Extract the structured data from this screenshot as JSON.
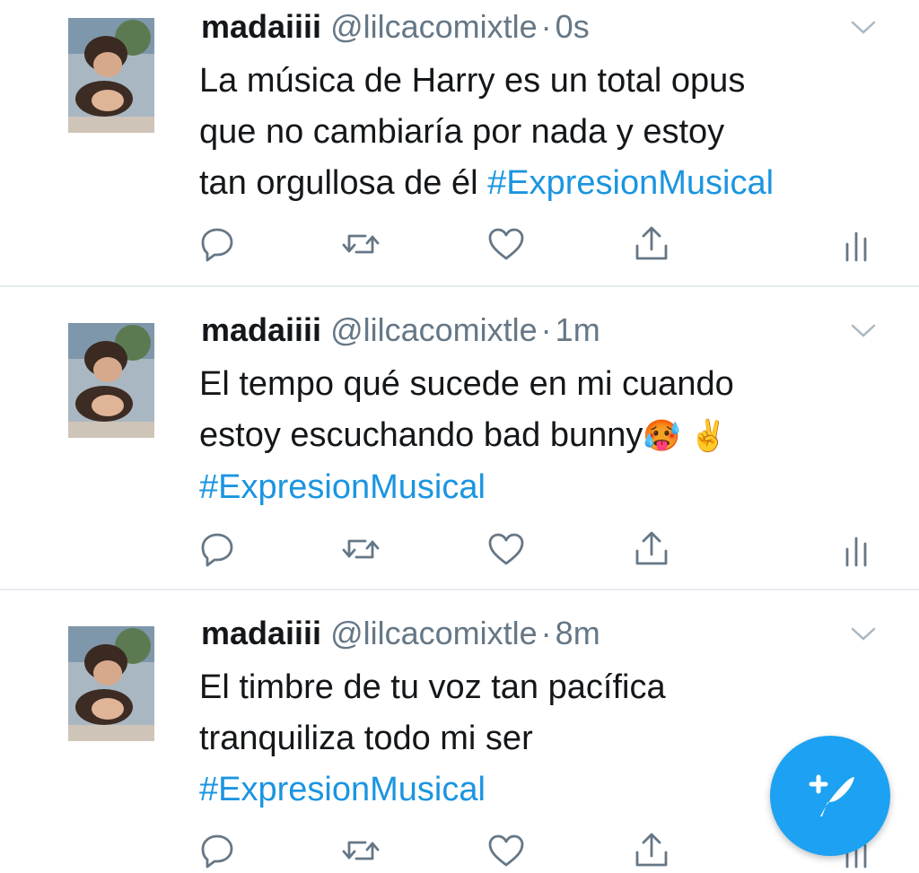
{
  "timeline": {
    "tweets": [
      {
        "name": "madaiiii",
        "handle": "@lilcacomixtle",
        "separator": "·",
        "time": "0s",
        "lines": [
          "La música de Harry es un total opus",
          "que no cambiaría por nada y estoy",
          "tan orgullosa de él"
        ],
        "hashtag": "#ExpresionMusical"
      },
      {
        "name": "madaiiii",
        "handle": "@lilcacomixtle",
        "separator": "·",
        "time": "1m",
        "lines": [
          "El tempo qué sucede en mi cuando",
          "estoy escuchando bad bunny"
        ],
        "emojis": "🥵 ✌️",
        "hashtag": "#ExpresionMusical"
      },
      {
        "name": "madaiiii",
        "handle": "@lilcacomixtle",
        "separator": "·",
        "time": "8m",
        "lines": [
          "El timbre de tu voz tan pacífica",
          "tranquiliza todo mi ser"
        ],
        "hashtag": "#ExpresionMusical"
      }
    ]
  },
  "icons": {
    "reply": "reply-icon",
    "retweet": "retweet-icon",
    "like": "like-icon",
    "share": "share-icon",
    "analytics": "analytics-icon",
    "menu": "chevron-down-icon",
    "compose": "compose-tweet-icon"
  },
  "colors": {
    "text": "#14171a",
    "secondary": "#657786",
    "link": "#1b95e0",
    "accent": "#1da1f2",
    "divider": "#e6ecf0"
  }
}
